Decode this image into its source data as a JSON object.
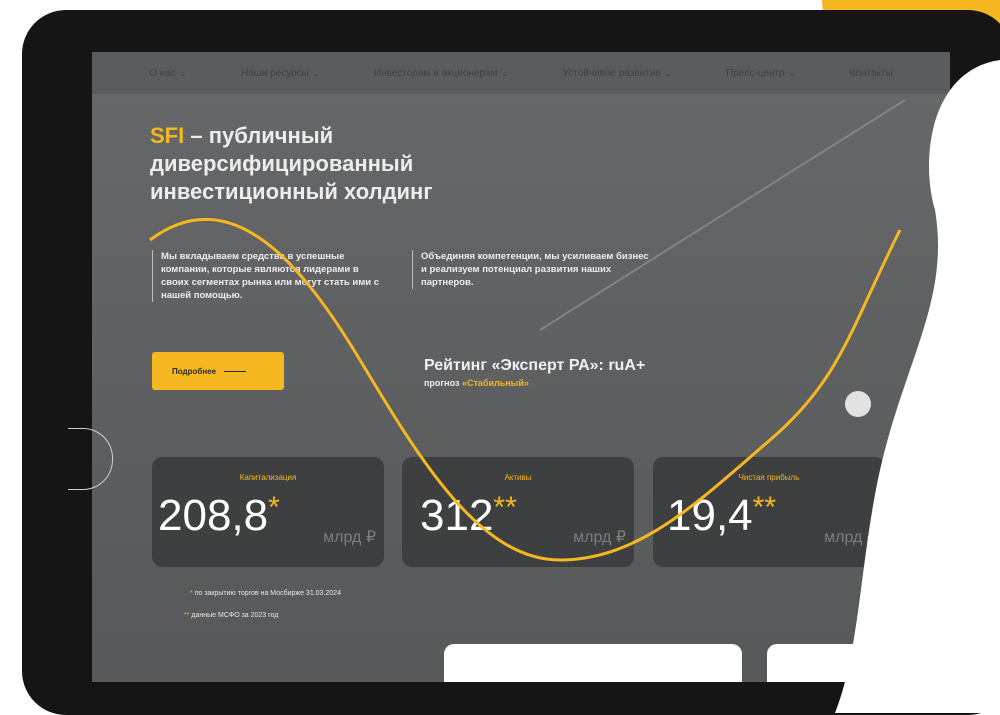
{
  "nav": {
    "items": [
      "О нас",
      "Наши ресурсы",
      "Инвесторам и акционерам",
      "Устойчивое развитие",
      "Пресс-центр",
      "Контакты"
    ]
  },
  "hero": {
    "brand": "SFI",
    "title_rest": " – публичный диверсифицированный инвестиционный холдинг"
  },
  "columns": {
    "left": "Мы вкладываем средства в успешные компании, которые являются лидерами в своих сегментах рынка или могут стать ими с нашей помощью.",
    "right": "Объединяя компетенции, мы усиливаем бизнес и реализуем потенциал развития наших партнеров."
  },
  "cta": {
    "label": "Подробнее"
  },
  "rating": {
    "title": "Рейтинг «Эксперт РА»: ruA+",
    "forecast_prefix": "прогноз ",
    "forecast_value": "«Стабильный»"
  },
  "stats": [
    {
      "label": "Капитализация",
      "value": "208,8",
      "stars": "*",
      "unit": "млрд ₽"
    },
    {
      "label": "Активы",
      "value": "312",
      "stars": "**",
      "unit": "млрд ₽"
    },
    {
      "label": "Чистая прибыль",
      "value": "19,4",
      "stars": "**",
      "unit": "млрд ₽"
    }
  ],
  "footnotes": [
    {
      "stars": "*",
      "text": "по закрытию торгов на Мосбирже 31.03.2024"
    },
    {
      "stars": "**",
      "text": "данные МСФО за 2023 год"
    }
  ],
  "colors": {
    "accent": "#f5b820",
    "card": "#3e3f41",
    "bezel": "#151515"
  }
}
